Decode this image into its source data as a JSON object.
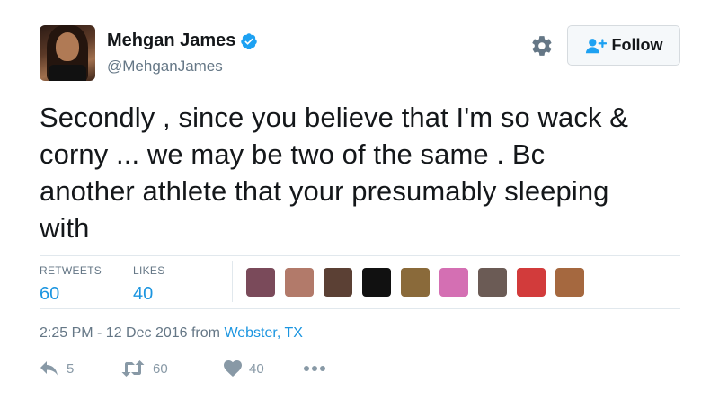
{
  "user": {
    "display_name": "Mehgan James",
    "handle": "@MehganJames",
    "verified": true
  },
  "follow_button": {
    "label": "Follow"
  },
  "tweet": {
    "lines": [
      "Secondly , since you believe that I'm so wack &",
      "corny ... we may be two of the same . Bc",
      "another athlete that your presumably sleeping",
      "with"
    ]
  },
  "stats": {
    "retweets_label": "RETWEETS",
    "retweets_value": "60",
    "likes_label": "LIKES",
    "likes_value": "40"
  },
  "likers": [
    {
      "color": "#7a4a5a"
    },
    {
      "color": "#b27a6a"
    },
    {
      "color": "#5b4034"
    },
    {
      "color": "#111111"
    },
    {
      "color": "#8a6a3a"
    },
    {
      "color": "#d46fb3"
    },
    {
      "color": "#6b5b55"
    },
    {
      "color": "#d23b3b"
    },
    {
      "color": "#a5683f"
    }
  ],
  "meta": {
    "time_date": "2:25 PM - 12 Dec 2016 from ",
    "location": "Webster, TX"
  },
  "actions": {
    "reply_count": "5",
    "retweet_count": "60",
    "like_count": "40"
  },
  "colors": {
    "accent": "#1b95e0",
    "secondary_text": "#657786",
    "verified": "#1da1f2"
  }
}
